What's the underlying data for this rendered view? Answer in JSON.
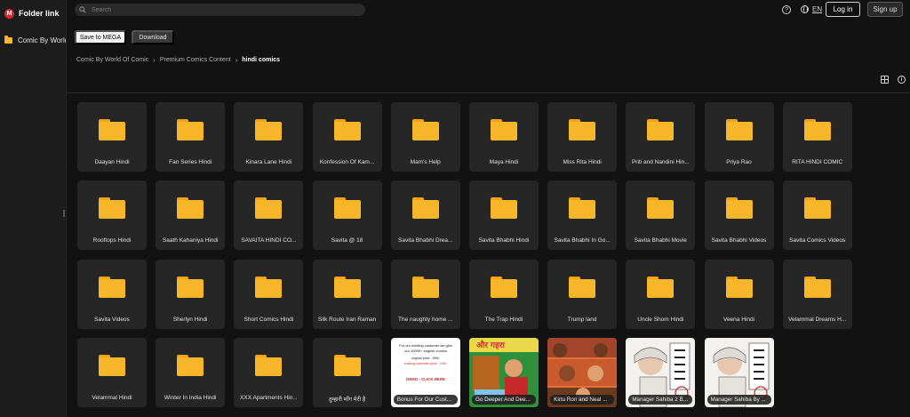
{
  "app": {
    "logo_letter": "M",
    "title": "Folder link"
  },
  "sidebar": {
    "items": [
      {
        "label": "Comic By World"
      }
    ]
  },
  "search": {
    "placeholder": "Search"
  },
  "header": {
    "language": "EN",
    "login_label": "Log in",
    "signup_label": "Sign up"
  },
  "toolbar": {
    "save_label": "Save to MEGA",
    "download_label": "Download"
  },
  "breadcrumb": [
    "Comic By World Of Comic",
    "Premium Comics Content",
    "hindi comics"
  ],
  "colors": {
    "folder": "#f8b62b",
    "brand": "#d9272e",
    "background": "#121212",
    "tile": "#262626"
  },
  "folders": [
    "Daayan Hindi",
    "Fan Series Hindi",
    "Kinara Lane Hindi",
    "Konfession Of Kam...",
    "Mam's Help",
    "Maya Hindi",
    "Miss Rita Hindi",
    "Priti and Nandini Hin...",
    "Priya Rao",
    "RITA HINDI COMIC",
    "Rooftops Hindi",
    "Saath Kahaniya Hindi",
    "SAVAITA HINDI CO...",
    "Savita @ 18",
    "Savita Bhabhi Drea...",
    "Savita Bhabhi Hindi",
    "Savita Bhabhi In Go...",
    "Savita Bhabhi Movie",
    "Savita Bhabhi Videos",
    "Savita Comics Videos",
    "Savita Videos",
    "Sherlyn Hindi",
    "Short Comics Hindi",
    "Silk Route Iran Raman",
    "The naughty home ...",
    "The Trap Hindi",
    "Trump land",
    "Uncle Shom Hindi",
    "Veena Hindi",
    "Velammal Dreams H...",
    "Velammal Hindi",
    "Winter In India Hindi",
    "XXX Apartments Hin...",
    "तुम्हारी माँग मेरी है"
  ],
  "files": [
    {
      "label": "Bonus For Our Cust...",
      "thumb": "promo",
      "lines": [
        "For our existing customer we give",
        "our 10000+ english comics",
        "original price - 999/-",
        "existing customer price - 199/-",
        "DEMO - CLICK HERE"
      ]
    },
    {
      "label": "Go Deeper And Dee...",
      "thumb": "comic-green",
      "lines": [
        "और गहरा"
      ]
    },
    {
      "label": "Kirtu Ron and Neal ...",
      "thumb": "comic-orange",
      "lines": []
    },
    {
      "label": "Manager Sahiba 2 B...",
      "thumb": "manga",
      "lines": []
    },
    {
      "label": "Manager Sahiba By ...",
      "thumb": "manga",
      "lines": []
    }
  ]
}
